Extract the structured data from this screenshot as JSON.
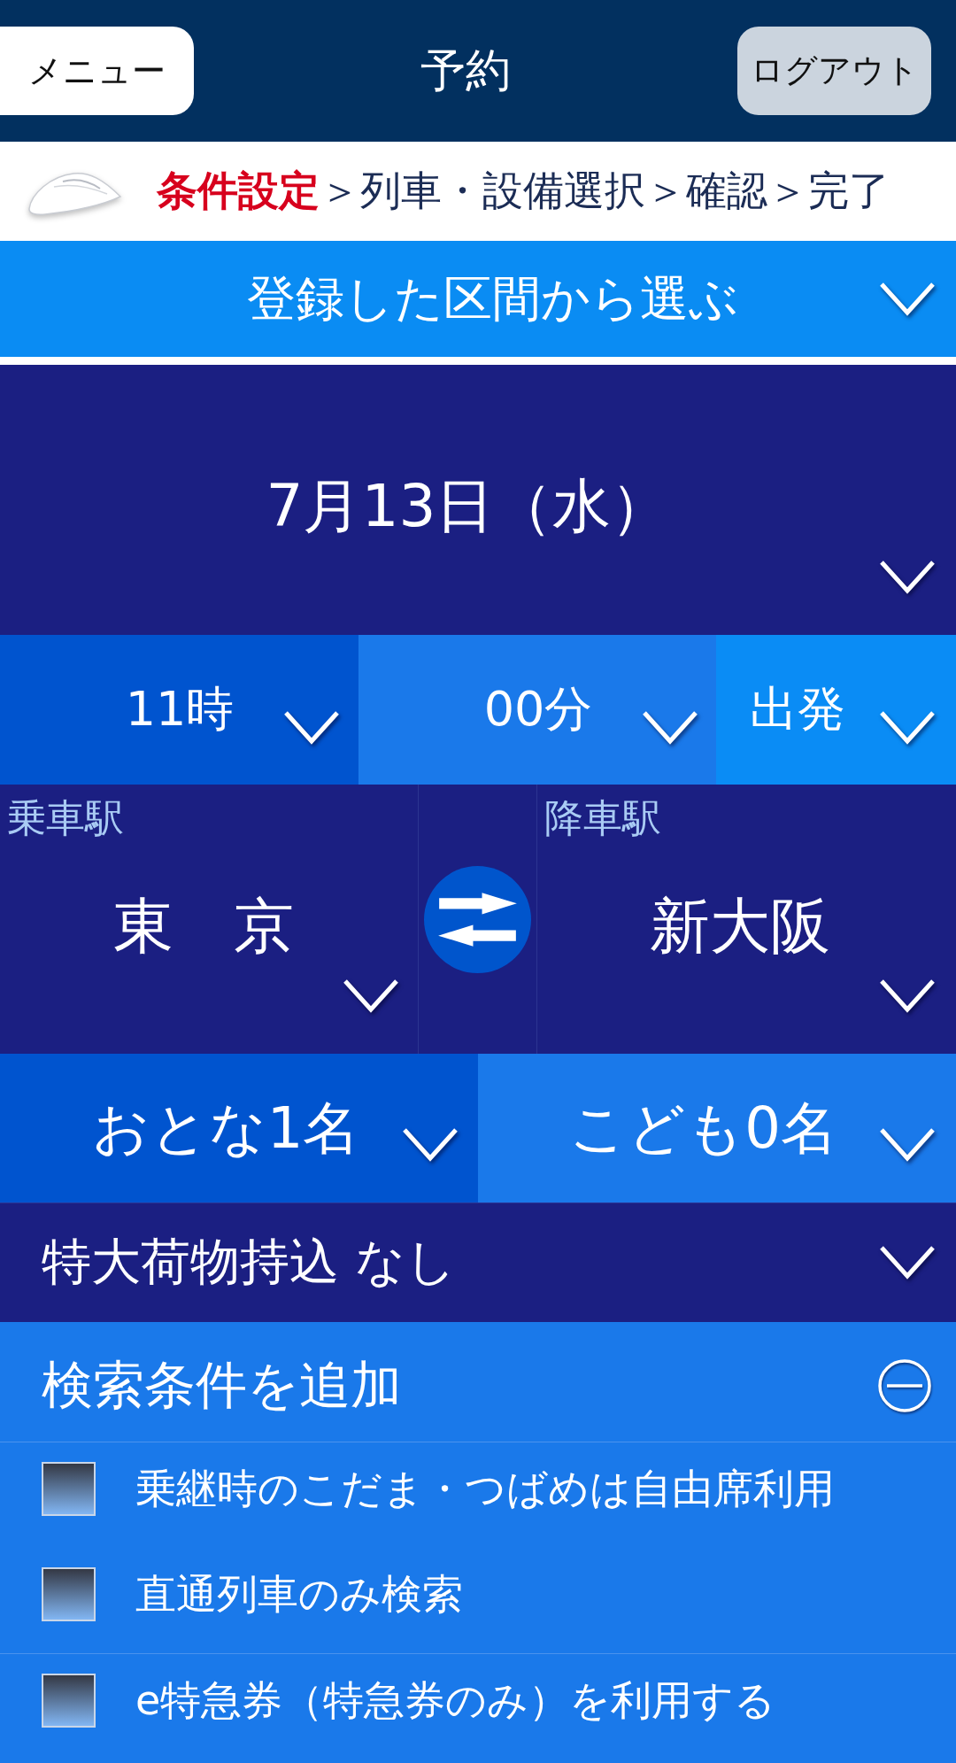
{
  "header": {
    "menu_button": "メニュー",
    "title": "予約",
    "logout_button": "ログアウト"
  },
  "steps": [
    {
      "label": "条件設定",
      "selected": true
    },
    {
      "separator": "＞",
      "label": "列車・設備選択",
      "selected": false
    },
    {
      "separator": "＞",
      "label": "確認",
      "selected": false
    },
    {
      "separator": "＞",
      "label": "完了",
      "selected": false
    }
  ],
  "saved_route": {
    "label": "登録した区間から選ぶ"
  },
  "date": {
    "value": "7月13日（水）"
  },
  "time": [
    {
      "value": "11時"
    },
    {
      "value": "00分"
    },
    {
      "value": "出発"
    }
  ],
  "stations": [
    {
      "label": "乗車駅",
      "value": "東　京"
    },
    {
      "label": "降車駅",
      "value": "新大阪"
    }
  ],
  "passengers": [
    {
      "value": "おとな1名"
    },
    {
      "value": "こども0名"
    }
  ],
  "luggage": {
    "value": "特大荷物持込 なし"
  },
  "search_options": {
    "title": "検索条件を追加",
    "expanded": true,
    "groups": [
      {
        "options": [
          {
            "label": "乗継時のこだま・つばめは自由席利用",
            "checked": false
          },
          {
            "label": "直通列車のみ検索",
            "checked": false
          }
        ]
      },
      {
        "options": [
          {
            "label": "e特急券（特急券のみ）を利用する",
            "checked": false
          }
        ]
      }
    ]
  }
}
